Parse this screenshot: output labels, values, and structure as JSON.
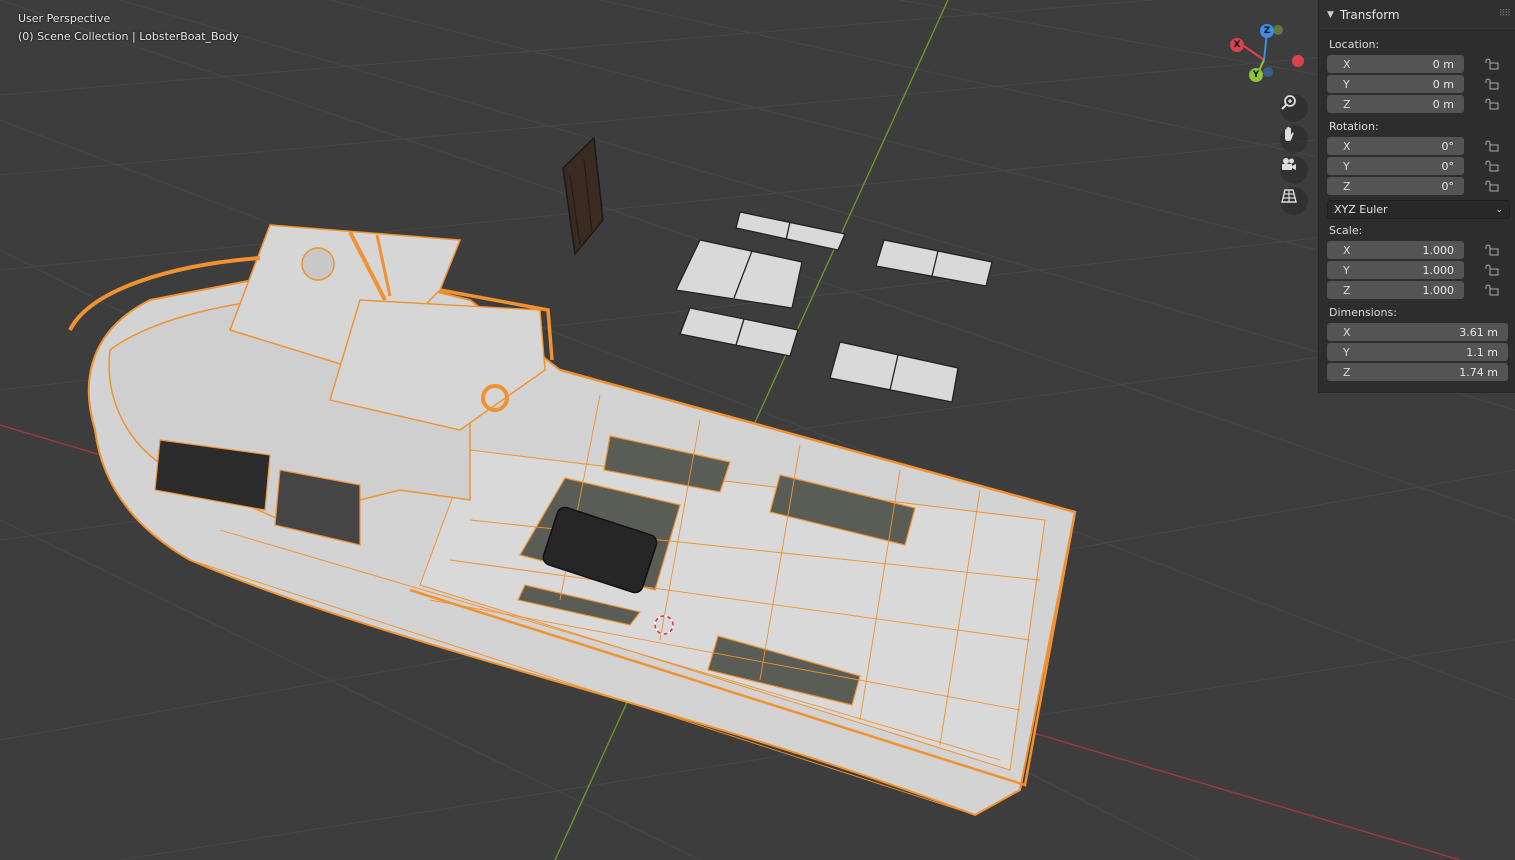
{
  "viewport": {
    "view_name": "User Perspective",
    "collection_info": "(0) Scene Collection | LobsterBoat_Body",
    "object_selected_color": "#f0922f",
    "axis_x_color": "#b23b3b",
    "axis_y_color": "#6f9a2b",
    "background_color": "#3d3d3d"
  },
  "gizmo": {
    "x_label": "X",
    "y_label": "Y",
    "z_label": "Z",
    "x_color": "#d9434f",
    "y_color": "#8ac53a",
    "z_color": "#3d8ee6"
  },
  "nav_tools": [
    {
      "icon": "zoom-icon"
    },
    {
      "icon": "hand-icon"
    },
    {
      "icon": "camera-icon"
    },
    {
      "icon": "grid-icon"
    }
  ],
  "transform_panel": {
    "title": "Transform",
    "location": {
      "label": "Location:",
      "fields": [
        {
          "axis": "X",
          "value": "0 m"
        },
        {
          "axis": "Y",
          "value": "0 m"
        },
        {
          "axis": "Z",
          "value": "0 m"
        }
      ]
    },
    "rotation": {
      "label": "Rotation:",
      "fields": [
        {
          "axis": "X",
          "value": "0°"
        },
        {
          "axis": "Y",
          "value": "0°"
        },
        {
          "axis": "Z",
          "value": "0°"
        }
      ],
      "mode": "XYZ Euler"
    },
    "scale": {
      "label": "Scale:",
      "fields": [
        {
          "axis": "X",
          "value": "1.000"
        },
        {
          "axis": "Y",
          "value": "1.000"
        },
        {
          "axis": "Z",
          "value": "1.000"
        }
      ]
    },
    "dimensions": {
      "label": "Dimensions:",
      "fields": [
        {
          "axis": "X",
          "value": "3.61 m"
        },
        {
          "axis": "Y",
          "value": "1.1 m"
        },
        {
          "axis": "Z",
          "value": "1.74 m"
        }
      ]
    }
  }
}
